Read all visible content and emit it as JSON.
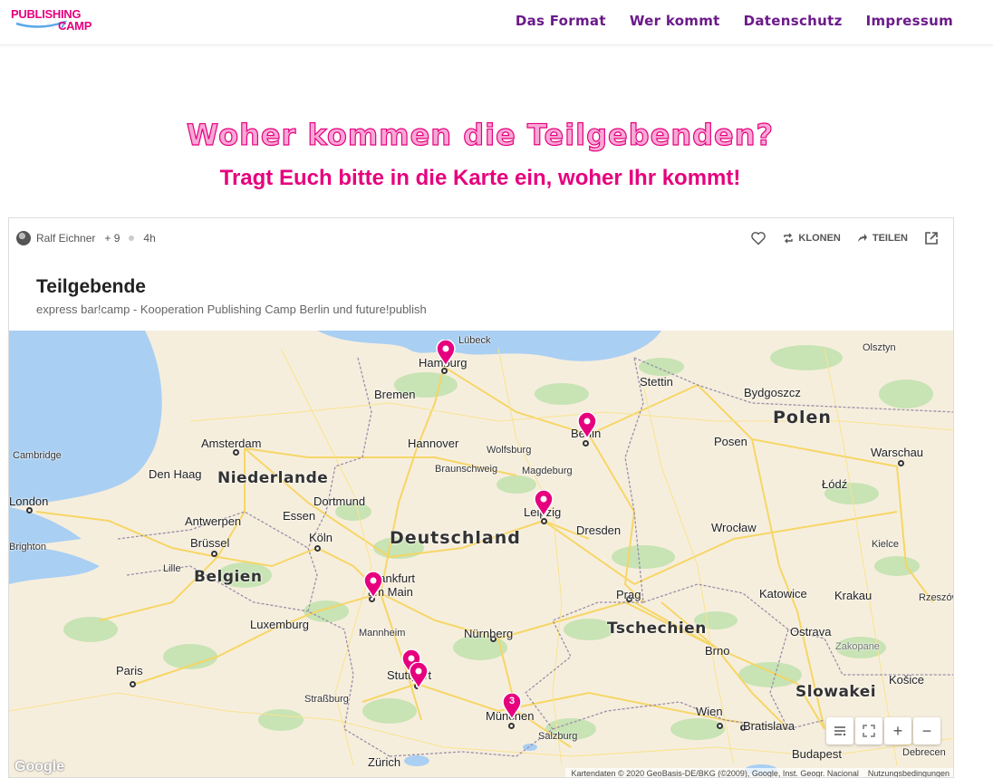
{
  "header": {
    "logo_line1": "PUBLISHING",
    "logo_line2": "CAMP",
    "nav": [
      "Das Format",
      "Wer kommt",
      "Datenschutz",
      "Impressum"
    ]
  },
  "hero": {
    "title": "Woher kommen die Teilgebenden?",
    "subtitle": "Tragt Euch bitte in die Karte ein, woher Ihr kommt!"
  },
  "card": {
    "author": "Ralf Eichner",
    "likes": "+ 9",
    "age": "4h",
    "clone_label": "KLONEN",
    "share_label": "TEILEN",
    "title": "Teilgebende",
    "subtitle": "express bar!camp - Kooperation Publishing Camp Berlin und future!publish"
  },
  "map": {
    "countries": [
      "Deutschland",
      "Polen",
      "Niederlande",
      "Belgien",
      "Tschechien",
      "Slowakei"
    ],
    "cities": [
      "Lübeck",
      "Hamburg",
      "Bremen",
      "Stettin",
      "Bydgoszcz",
      "Olsztyn",
      "Berlin",
      "Hannover",
      "Wolfsburg",
      "Braunschweig",
      "Magdeburg",
      "Posen",
      "Warschau",
      "Amsterdam",
      "Den Haag",
      "Cambridge",
      "London",
      "Dortmund",
      "Essen",
      "Leipzig",
      "Dresden",
      "Wrocław",
      "Łódź",
      "Antwerpen",
      "Brüssel",
      "Köln",
      "Kielce",
      "Brighton",
      "Lille",
      "Frankfurt am Main",
      "Prag",
      "Katowice",
      "Krakau",
      "Rzeszów",
      "Luxemburg",
      "Mannheim",
      "Nürnberg",
      "Ostrava",
      "Brno",
      "Zakopane",
      "Paris",
      "Stuttgart",
      "Straßburg",
      "München",
      "Košice",
      "Wien",
      "Bratislava",
      "Salzburg",
      "Zürich",
      "Budapest",
      "Debrecen"
    ],
    "cluster_count": "3",
    "attribution": "Kartendaten © 2020 GeoBasis-DE/BKG (©2009), Google, Inst. Geogr. Nacional",
    "terms": "Nutzungsbedingungen",
    "google": "Google",
    "zoom_in": "+",
    "zoom_out": "−",
    "colors": {
      "pin": "#e6007e",
      "water": "#a9cff3",
      "land": "#f6eedd",
      "green": "#c8e3b4",
      "roads": "#f7d560"
    }
  }
}
